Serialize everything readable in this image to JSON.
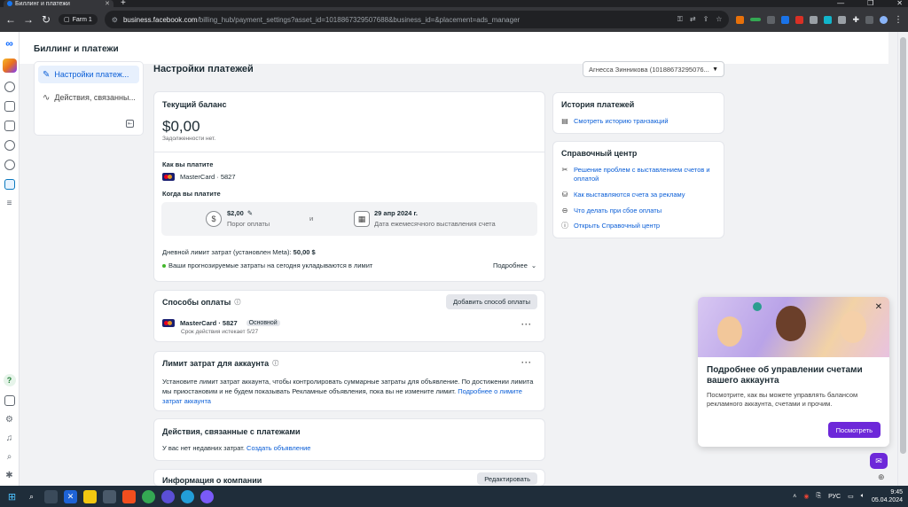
{
  "browser": {
    "tab_title": "Биллинг и платежи",
    "profile_label": "Farm 1",
    "url_host": "business.facebook.com",
    "url_path": "/billing_hub/payment_settings?asset_id=1018867329507688&business_id=&placement=ads_manager"
  },
  "page": {
    "heading": "Биллинг и платежи"
  },
  "left_nav": {
    "items": [
      {
        "label": "Настройки платеж..."
      },
      {
        "label": "Действия, связанны..."
      }
    ]
  },
  "main": {
    "title": "Настройки платежей",
    "account_selector": "Агнесса Зинникова (10188673295076..."
  },
  "balance": {
    "title": "Текущий баланс",
    "amount": "$0,00",
    "no_debt": "Задолженности нет.",
    "how_you_pay": "Как вы платите",
    "card": "MasterCard · 5827",
    "when_you_pay": "Когда вы платите",
    "threshold_value": "$2,00",
    "threshold_label": "Порог оплаты",
    "and": "и",
    "billing_date": "29 апр 2024 г.",
    "billing_date_label": "Дата ежемесячного выставления счета",
    "daily_limit": "Дневной лимит затрат (установлен Meta):",
    "daily_limit_value": "50,00 $",
    "forecast_status": "Ваши прогнозируемые затраты на сегодня укладываются в лимит",
    "more": "Подробнее"
  },
  "payment_methods": {
    "title": "Способы оплаты",
    "add_button": "Добавить способ оплаты",
    "card": "MasterCard · 5827",
    "primary_badge": "Основной",
    "expiry": "Срок действия истекает 5/27"
  },
  "spend_limit": {
    "title": "Лимит затрат для аккаунта",
    "text": "Установите лимит затрат аккаунта, чтобы контролировать суммарные затраты для объявление. По достижении лимита мы приостановим и не будем показывать Рекламные объявления, пока вы не измените лимит.",
    "link": "Подробнее о лимите затрат аккаунта"
  },
  "payment_activity": {
    "title": "Действия, связанные с платежами",
    "text": "У вас нет недавних затрат.",
    "link": "Создать объявление"
  },
  "company_info": {
    "title": "Информация о компании",
    "edit_button": "Редактировать"
  },
  "history": {
    "title": "История платежей",
    "link": "Смотреть историю транзакций"
  },
  "help_center": {
    "title": "Справочный центр",
    "links": [
      "Решение проблем с выставлением счетов и оплатой",
      "Как выставляются счета за рекламу",
      "Что делать при сбое оплаты",
      "Открыть Справочный центр"
    ]
  },
  "promo": {
    "title": "Подробнее об управлении счетами вашего аккаунта",
    "text": "Посмотрите, как вы можете управлять балансом рекламного аккаунта, счетами и прочим.",
    "button": "Посмотреть"
  },
  "taskbar": {
    "lang": "РУС",
    "time": "9:45",
    "date": "05.04.2024"
  },
  "colors": {
    "accent": "#0a5ed7",
    "promo_button": "#6d28d9",
    "status_ok": "#42b72a"
  }
}
